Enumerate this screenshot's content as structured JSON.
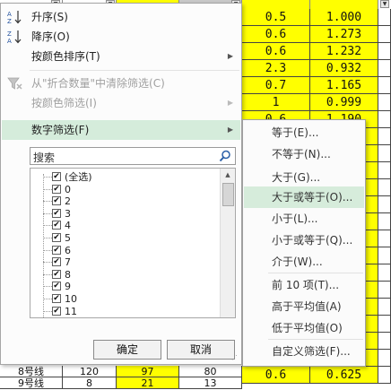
{
  "sheet": {
    "right_rows": [
      [
        "0.5",
        "1.000"
      ],
      [
        "0.6",
        "1.273"
      ],
      [
        "0.6",
        "1.232"
      ],
      [
        "2.3",
        "0.932"
      ],
      [
        "0.7",
        "1.165"
      ],
      [
        "1",
        "0.999"
      ],
      [
        "0.6",
        "1.190"
      ],
      [
        "",
        ""
      ],
      [
        "",
        ""
      ],
      [
        "",
        ""
      ],
      [
        "",
        ""
      ],
      [
        "",
        ""
      ],
      [
        "",
        ""
      ],
      [
        "",
        ""
      ],
      [
        "",
        ""
      ],
      [
        "",
        ""
      ],
      [
        "",
        ""
      ],
      [
        "",
        ""
      ],
      [
        "",
        ""
      ],
      [
        "",
        ""
      ],
      [
        "1.5",
        "0.828"
      ],
      [
        "0.6",
        "0.625"
      ]
    ],
    "bottom_rows": [
      [
        "8号线",
        "120",
        "97",
        "80"
      ],
      [
        "9号线",
        "8",
        "21",
        "13"
      ]
    ],
    "filter_arrow": "▼",
    "colors": {
      "highlight": "#ffff00",
      "menu_hover": "#d5ecdb"
    }
  },
  "menu": {
    "sort_asc": {
      "label": "升序(S)",
      "icon": "sort-ascending-icon"
    },
    "sort_desc": {
      "label": "降序(O)",
      "icon": "sort-descending-icon"
    },
    "sort_by_color": {
      "label": "按颜色排序(T)"
    },
    "clear_filter": {
      "label": "从\"折合数量\"中清除筛选(C)",
      "icon": "clear-filter-icon"
    },
    "filter_by_color": {
      "label": "按颜色筛选(I)"
    },
    "number_filter": {
      "label": "数字筛选(F)"
    },
    "search": {
      "placeholder": "搜索",
      "icon": "magnifier-icon"
    },
    "values": [
      {
        "label": "(全选)",
        "checked": true
      },
      {
        "label": "0",
        "checked": true
      },
      {
        "label": "2",
        "checked": true
      },
      {
        "label": "3",
        "checked": true
      },
      {
        "label": "4",
        "checked": true
      },
      {
        "label": "5",
        "checked": true
      },
      {
        "label": "6",
        "checked": true
      },
      {
        "label": "7",
        "checked": true
      },
      {
        "label": "8",
        "checked": true
      },
      {
        "label": "9",
        "checked": true
      },
      {
        "label": "10",
        "checked": true
      },
      {
        "label": "11",
        "checked": true
      }
    ],
    "ok_label": "确定",
    "cancel_label": "取消",
    "check_mark": "✔",
    "submenu_arrow": "▶"
  },
  "submenu": {
    "items": [
      "等于(E)...",
      "不等于(N)...",
      "大于(G)...",
      "大于或等于(O)...",
      "小于(L)...",
      "小于或等于(Q)...",
      "介于(W)...",
      "前 10 项(T)...",
      "高于平均值(A)",
      "低于平均值(O)",
      "自定义筛选(F)..."
    ]
  }
}
